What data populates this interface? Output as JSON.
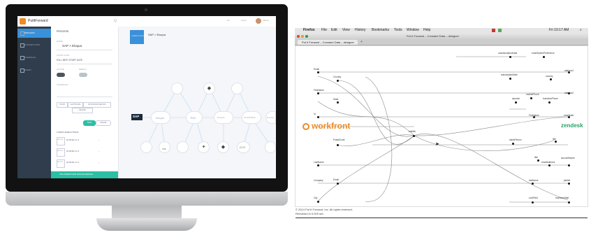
{
  "left_monitor": {
    "topbar": {
      "logo": "PutItForward",
      "search_placeholder": "Q",
      "links": [
        "Go",
        "Learn"
      ],
      "user": "Bruce"
    },
    "nav": {
      "items": [
        "PROCESS",
        "CONNECTIONS",
        "SCHEDULE",
        "EVENT"
      ]
    },
    "form": {
      "section_title": "PROCESS",
      "name_label": "NAME",
      "name_value": "SAP > Eloqua",
      "start_date_label": "START DATE",
      "start_date_value": "PULL BEST START DATE",
      "active_label": "ACTIVE",
      "debug_label": "DEBUG",
      "schedule_label": "SCHEDULE",
      "day_buttons": [
        "HOUR",
        "DAY/HOURS",
        "DAY/HOURS PER DAY"
      ],
      "delete_button": "DELETE",
      "save_button": "SAVE",
      "cancel_button": "CANCEL",
      "executions_title": "LATEST EXECUTIONS",
      "executions": [
        {
          "date": "NOV 26",
          "time": "10:30:00 1.1.3"
        },
        {
          "date": "NOV 26",
          "time": "10:30:00 1.1.3"
        },
        {
          "date": "NOV 26",
          "time": "10:30:00 1.1.3"
        }
      ],
      "status_text": "THE CONNECTIONS NOW SUCCESSFUL"
    },
    "canvas": {
      "process_chip": "CURRENT PROCESS",
      "process_title": "SAP > Eloqua",
      "source_label": "SAP",
      "pipeline_nodes": [
        "eloqua",
        "box",
        "ELOQUA",
        "SALESFORCE",
        "ELOQUA"
      ],
      "top_icons": [
        "doc-icon",
        "lion-icon",
        "grid-icon"
      ],
      "bottom_icons": [
        "sheet-icon",
        "xml-icon",
        "doc-icon",
        "twitter-icon",
        "lion-icon",
        "json-icon",
        "grid-icon"
      ],
      "bottom_labels": [
        "",
        "XML",
        "",
        "",
        "",
        "json",
        ""
      ]
    }
  },
  "right_screenshot": {
    "menubar": {
      "items": [
        "Firefox",
        "File",
        "Edit",
        "View",
        "History",
        "Bookmarks",
        "Tools",
        "Window",
        "Help"
      ],
      "clock": "Fri 10:17 AM"
    },
    "window_title": "Put It Forward – Constant Data – designer",
    "tab_title": "Put It Forward – Constant Data – designer",
    "left_brand": "workfront",
    "right_brand": "zendesk",
    "center_node": "entitlek",
    "left_fields": [
      "Email",
      "Country",
      "FirstName",
      "State",
      "Id",
      "PostalCode",
      "LastName",
      "Email",
      "Company",
      "City"
    ],
    "right_fields": [
      "unsubscriptionDate",
      "emailOptionPreference",
      "subscriptionDate",
      "country",
      "address1",
      "mobilePhone",
      "businessPhone",
      "zipcode",
      "address2",
      "FirstName",
      "emailAddr",
      "salesPerson",
      "title",
      "title",
      "emailAddress",
      "accountName",
      "lastName",
      "jobtitle",
      "custField",
      "businessDate"
    ],
    "footer": [
      "© 2014 Put It Forward, Inc. All rights reserved.",
      "Rendered in 0.000 sec"
    ]
  }
}
